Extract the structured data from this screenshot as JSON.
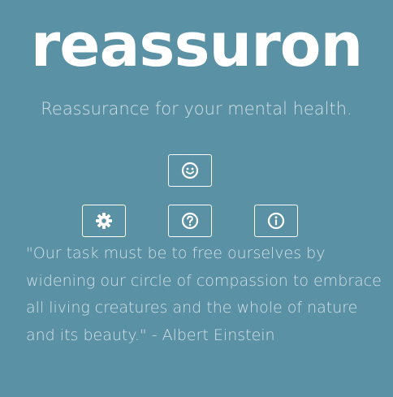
{
  "app": {
    "title": "reassuron",
    "tagline": "Reassurance for your mental health."
  },
  "buttons": [
    {
      "name": "mood-button",
      "icon": "smiley-icon"
    },
    {
      "name": "settings-button",
      "icon": "gear-icon"
    },
    {
      "name": "help-button",
      "icon": "question-circle-icon"
    },
    {
      "name": "info-button",
      "icon": "info-circle-icon"
    }
  ],
  "quote": {
    "text": "\"Our task must be to free ourselves by widening our circle of compassion to embrace all living creatures and the whole of nature and its beauty.\" - Albert Einstein"
  },
  "colors": {
    "background": "#5b91a5",
    "foreground": "#ffffff"
  }
}
